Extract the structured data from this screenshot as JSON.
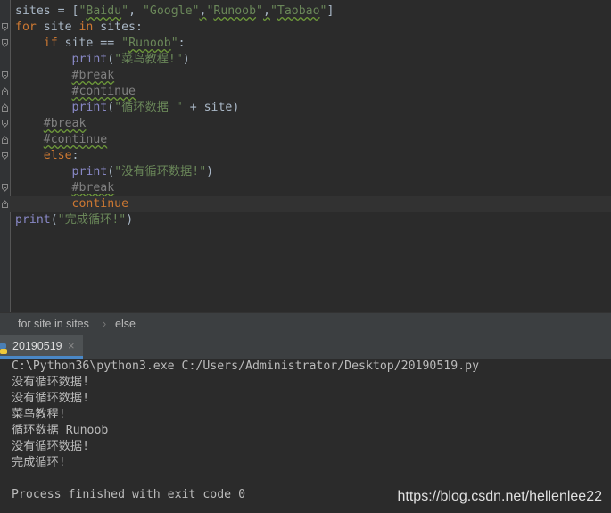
{
  "editor": {
    "lines": [
      {
        "parts": [
          {
            "t": "sites = [",
            "c": ""
          },
          {
            "t": "\"",
            "c": "str"
          },
          {
            "t": "Baidu",
            "c": "str sq"
          },
          {
            "t": "\"",
            "c": "str"
          },
          {
            "t": ", ",
            "c": ""
          },
          {
            "t": "\"Google\"",
            "c": "str"
          },
          {
            "t": ",",
            "c": "sq"
          },
          {
            "t": "\"",
            "c": "str"
          },
          {
            "t": "Runoob",
            "c": "str sq"
          },
          {
            "t": "\"",
            "c": "str"
          },
          {
            "t": ",",
            "c": "sq"
          },
          {
            "t": "\"",
            "c": "str"
          },
          {
            "t": "Taobao",
            "c": "str sq"
          },
          {
            "t": "\"",
            "c": "str"
          },
          {
            "t": "]",
            "c": ""
          }
        ]
      },
      {
        "fold": "open",
        "parts": [
          {
            "t": "for",
            "c": "kw"
          },
          {
            "t": " site ",
            "c": ""
          },
          {
            "t": "in",
            "c": "kw"
          },
          {
            "t": " sites:",
            "c": ""
          }
        ]
      },
      {
        "fold": "open",
        "parts": [
          {
            "t": "    ",
            "c": ""
          },
          {
            "t": "if",
            "c": "kw"
          },
          {
            "t": " site == ",
            "c": ""
          },
          {
            "t": "\"",
            "c": "str"
          },
          {
            "t": "Runoob",
            "c": "str sq"
          },
          {
            "t": "\"",
            "c": "str"
          },
          {
            "t": ":",
            "c": ""
          }
        ]
      },
      {
        "parts": [
          {
            "t": "        ",
            "c": ""
          },
          {
            "t": "print",
            "c": "fn"
          },
          {
            "t": "(",
            "c": ""
          },
          {
            "t": "\"菜鸟教程!\"",
            "c": "str"
          },
          {
            "t": ")",
            "c": ""
          }
        ]
      },
      {
        "fold": "open",
        "parts": [
          {
            "t": "        ",
            "c": ""
          },
          {
            "t": "#break",
            "c": "cm sqc"
          }
        ]
      },
      {
        "fold": "close",
        "parts": [
          {
            "t": "        ",
            "c": ""
          },
          {
            "t": "#continue",
            "c": "cm sqc"
          }
        ]
      },
      {
        "fold": "close",
        "parts": [
          {
            "t": "        ",
            "c": ""
          },
          {
            "t": "print",
            "c": "fn"
          },
          {
            "t": "(",
            "c": ""
          },
          {
            "t": "\"循环数据 \"",
            "c": "str"
          },
          {
            "t": " + site)",
            "c": ""
          }
        ]
      },
      {
        "fold": "open",
        "parts": [
          {
            "t": "    ",
            "c": ""
          },
          {
            "t": "#break",
            "c": "cm sqc"
          }
        ]
      },
      {
        "fold": "close",
        "parts": [
          {
            "t": "    ",
            "c": ""
          },
          {
            "t": "#continue",
            "c": "cm sqc"
          }
        ]
      },
      {
        "fold": "open",
        "parts": [
          {
            "t": "    ",
            "c": ""
          },
          {
            "t": "else",
            "c": "kw"
          },
          {
            "t": ":",
            "c": ""
          }
        ]
      },
      {
        "parts": [
          {
            "t": "        ",
            "c": ""
          },
          {
            "t": "print",
            "c": "fn"
          },
          {
            "t": "(",
            "c": ""
          },
          {
            "t": "\"没有循环数据!\"",
            "c": "str"
          },
          {
            "t": ")",
            "c": ""
          }
        ]
      },
      {
        "fold": "open",
        "parts": [
          {
            "t": "        ",
            "c": ""
          },
          {
            "t": "#break",
            "c": "cm sqc"
          }
        ]
      },
      {
        "fold": "close",
        "current": true,
        "parts": [
          {
            "t": "        ",
            "c": ""
          },
          {
            "t": "continue",
            "c": "kw"
          }
        ]
      },
      {
        "parts": [
          {
            "t": "print",
            "c": "fn"
          },
          {
            "t": "(",
            "c": ""
          },
          {
            "t": "\"完成循环!\"",
            "c": "str"
          },
          {
            "t": ")",
            "c": ""
          }
        ]
      }
    ]
  },
  "breadcrumb": {
    "items": [
      "for site in sites",
      "else"
    ],
    "separator": "›"
  },
  "run": {
    "tab_label": "20190519",
    "close": "×"
  },
  "console": {
    "lines": [
      "C:\\Python36\\python3.exe C:/Users/Administrator/Desktop/20190519.py",
      "没有循环数据!",
      "没有循环数据!",
      "菜鸟教程!",
      "循环数据 Runoob",
      "没有循环数据!",
      "完成循环!",
      "",
      "Process finished with exit code 0"
    ]
  },
  "watermark": "https://blog.csdn.net/hellenlee22",
  "colors": {
    "keyword": "#cc7832",
    "string": "#6a8759",
    "comment": "#808080",
    "builtin": "#8888c6",
    "text": "#a9b7c6",
    "background": "#2b2b2b"
  }
}
